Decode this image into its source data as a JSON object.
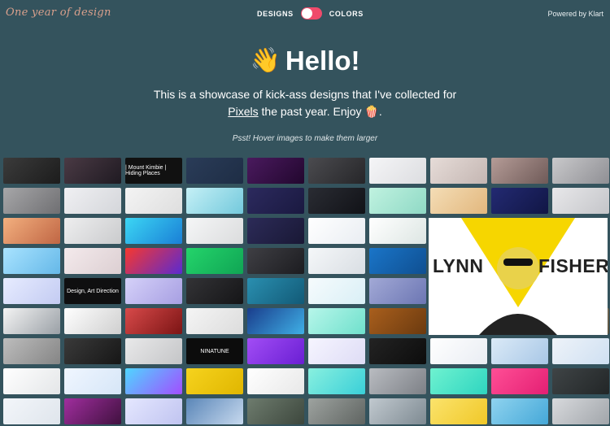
{
  "header": {
    "logo": "One year of design",
    "toggle_left": "DESIGNS",
    "toggle_right": "COLORS",
    "powered": "Powered by Klart"
  },
  "hero": {
    "wave_icon": "👋",
    "title": "Hello!",
    "intro_before": "This is a showcase of kick-ass designs that I've collected for ",
    "intro_link": "Pixels",
    "intro_after": " the past year. Enjoy ",
    "popcorn_icon": "🍿",
    "intro_end": ".",
    "hint": "Psst! Hover images to make them larger"
  },
  "tiles": [
    {
      "row": 0,
      "col": 0,
      "bg": "linear-gradient(135deg,#3b3b3b,#1c1c1c)"
    },
    {
      "row": 0,
      "col": 1,
      "bg": "linear-gradient(135deg,#4a3a44,#1f1a22)"
    },
    {
      "row": 0,
      "col": 2,
      "bg": "#111111",
      "text": "| Mount Kimbie | Hiding Places"
    },
    {
      "row": 0,
      "col": 3,
      "bg": "linear-gradient(135deg,#2a3c58,#1e2d45)"
    },
    {
      "row": 0,
      "col": 4,
      "bg": "linear-gradient(135deg,#4a1a5e,#22072e)"
    },
    {
      "row": 0,
      "col": 5,
      "bg": "linear-gradient(135deg,#4b4b4f,#262629)"
    },
    {
      "row": 0,
      "col": 6,
      "bg": "linear-gradient(135deg,#f5f5f7,#dcdde0)"
    },
    {
      "row": 0,
      "col": 7,
      "bg": "linear-gradient(135deg,#e6dcd8,#c4b6b2)"
    },
    {
      "row": 0,
      "col": 8,
      "bg": "linear-gradient(135deg,#b59c97,#6f5a58)"
    },
    {
      "row": 0,
      "col": 9,
      "bg": "linear-gradient(135deg,#c9c9cb,#8f8f94)"
    },
    {
      "row": 1,
      "col": 0,
      "bg": "linear-gradient(135deg,#a7a7a9,#6f6f72)"
    },
    {
      "row": 1,
      "col": 1,
      "bg": "linear-gradient(135deg,#f0f0f3,#d4d6da)"
    },
    {
      "row": 1,
      "col": 2,
      "bg": "linear-gradient(135deg,#f4f4f4,#dedede)"
    },
    {
      "row": 1,
      "col": 3,
      "bg": "linear-gradient(135deg,#c5f0f6,#73c9dc)"
    },
    {
      "row": 1,
      "col": 4,
      "bg": "linear-gradient(135deg,#2c2a5e,#1a1940)"
    },
    {
      "row": 1,
      "col": 5,
      "bg": "linear-gradient(135deg,#2a2c33,#111217)"
    },
    {
      "row": 1,
      "col": 6,
      "bg": "linear-gradient(135deg,#c0f2e0,#8fd9c5)"
    },
    {
      "row": 1,
      "col": 7,
      "bg": "linear-gradient(135deg,#f4ddb6,#e2b77d)"
    },
    {
      "row": 1,
      "col": 8,
      "bg": "linear-gradient(135deg,#232a72,#111645)"
    },
    {
      "row": 1,
      "col": 9,
      "bg": "linear-gradient(135deg,#e8e8ea,#c4c5c9)"
    },
    {
      "row": 2,
      "col": 0,
      "bg": "linear-gradient(135deg,#f3b07f,#c06644)"
    },
    {
      "row": 2,
      "col": 1,
      "bg": "linear-gradient(135deg,#eeeeef,#cacbcd)"
    },
    {
      "row": 2,
      "col": 2,
      "bg": "linear-gradient(135deg,#3cd6f4,#1a7fd6)"
    },
    {
      "row": 2,
      "col": 3,
      "bg": "linear-gradient(135deg,#f5f6f7,#dbdcdd)"
    },
    {
      "row": 2,
      "col": 4,
      "bg": "linear-gradient(135deg,#2c2b58,#191835)"
    },
    {
      "row": 2,
      "col": 5,
      "bg": "linear-gradient(135deg,#ffffff,#e9edf2)"
    },
    {
      "row": 2,
      "col": 6,
      "bg": "linear-gradient(135deg,#ffffff,#dde6e3)"
    },
    {
      "row": 3,
      "col": 0,
      "bg": "linear-gradient(135deg,#a9e3ff,#65b8e8)"
    },
    {
      "row": 3,
      "col": 1,
      "bg": "linear-gradient(135deg,#f4eaec,#dccfd2)"
    },
    {
      "row": 3,
      "col": 2,
      "bg": "linear-gradient(135deg,#f7382e,#5a2ad1)"
    },
    {
      "row": 3,
      "col": 3,
      "bg": "linear-gradient(135deg,#24d46b,#10a554)"
    },
    {
      "row": 3,
      "col": 4,
      "bg": "linear-gradient(135deg,#3f3f44,#1c1c20)"
    },
    {
      "row": 3,
      "col": 5,
      "bg": "linear-gradient(135deg,#f5f7f9,#d9dee3)"
    },
    {
      "row": 3,
      "col": 6,
      "bg": "linear-gradient(135deg,#1a75c8,#0f4f91)"
    },
    {
      "row": 4,
      "col": 0,
      "bg": "linear-gradient(135deg,#e7ecff,#c3cbf2)"
    },
    {
      "row": 4,
      "col": 1,
      "bg": "#0f0f10",
      "text": "Design, Art Direction"
    },
    {
      "row": 4,
      "col": 2,
      "bg": "linear-gradient(135deg,#d5d1f9,#a79fe2)"
    },
    {
      "row": 4,
      "col": 3,
      "bg": "linear-gradient(135deg,#333336,#151517)"
    },
    {
      "row": 4,
      "col": 4,
      "bg": "linear-gradient(135deg,#2a8fb0,#125a77)"
    },
    {
      "row": 4,
      "col": 5,
      "bg": "linear-gradient(135deg,#f6fbfd,#d9eff6)"
    },
    {
      "row": 4,
      "col": 6,
      "bg": "linear-gradient(135deg,#a2a9d6,#6c76b3)"
    },
    {
      "row": 5,
      "col": 0,
      "bg": "linear-gradient(135deg,#f4f4f4,#9aa0a6)"
    },
    {
      "row": 5,
      "col": 1,
      "bg": "linear-gradient(135deg,#ffffff,#cfcfcf)"
    },
    {
      "row": 5,
      "col": 2,
      "bg": "linear-gradient(135deg,#d84a4a,#7b1414)"
    },
    {
      "row": 5,
      "col": 3,
      "bg": "linear-gradient(135deg,#f5f5f5,#dcdcdc)"
    },
    {
      "row": 5,
      "col": 4,
      "bg": "linear-gradient(135deg,#1a3d8c,#3fb0e6)"
    },
    {
      "row": 5,
      "col": 5,
      "bg": "linear-gradient(135deg,#b7f6ea,#6fe0cc)"
    },
    {
      "row": 5,
      "col": 6,
      "bg": "linear-gradient(135deg,#a95f1d,#6b3a0f)"
    },
    {
      "row": 5,
      "col": 7,
      "bg": "linear-gradient(135deg,#d3cfcf,#8d8787)"
    },
    {
      "row": 5,
      "col": 8,
      "bg": "linear-gradient(135deg,#f7f9fb,#e1e7ee)"
    },
    {
      "row": 5,
      "col": 9,
      "bg": "linear-gradient(135deg,#8d8571,#595240)"
    },
    {
      "row": 6,
      "col": 0,
      "bg": "linear-gradient(135deg,#bdbdbd,#858585)"
    },
    {
      "row": 6,
      "col": 1,
      "bg": "linear-gradient(135deg,#3a3a3a,#161616)"
    },
    {
      "row": 6,
      "col": 2,
      "bg": "linear-gradient(135deg,#e9e9ea,#c4c5c7)"
    },
    {
      "row": 6,
      "col": 3,
      "bg": "#0c0c0c",
      "text": "NINATUNE"
    },
    {
      "row": 6,
      "col": 4,
      "bg": "linear-gradient(135deg,#a24df5,#6a1fd3)"
    },
    {
      "row": 6,
      "col": 5,
      "bg": "linear-gradient(135deg,#f6f5ff,#dedcf5)"
    },
    {
      "row": 6,
      "col": 6,
      "bg": "linear-gradient(135deg,#232323,#0c0c0c)"
    },
    {
      "row": 6,
      "col": 7,
      "bg": "linear-gradient(135deg,#ffffff,#e9edf3)"
    },
    {
      "row": 6,
      "col": 8,
      "bg": "linear-gradient(135deg,#dbeaf7,#a8c7e6)"
    },
    {
      "row": 6,
      "col": 9,
      "bg": "linear-gradient(135deg,#eef3f9,#cfe0f2)"
    },
    {
      "row": 7,
      "col": 0,
      "bg": "linear-gradient(135deg,#ffffff,#e4e6e8)"
    },
    {
      "row": 7,
      "col": 1,
      "bg": "linear-gradient(135deg,#f0f6ff,#d6e6f7)"
    },
    {
      "row": 7,
      "col": 2,
      "bg": "linear-gradient(135deg,#4fd6ff,#a24dff)"
    },
    {
      "row": 7,
      "col": 3,
      "bg": "linear-gradient(135deg,#f6d31e,#e0b600)"
    },
    {
      "row": 7,
      "col": 4,
      "bg": "linear-gradient(135deg,#ffffff,#e8e8e8)"
    },
    {
      "row": 7,
      "col": 5,
      "bg": "linear-gradient(135deg,#89f0df,#39cfd8)"
    },
    {
      "row": 7,
      "col": 6,
      "bg": "linear-gradient(135deg,#b9bcc1,#7d8086)"
    },
    {
      "row": 7,
      "col": 7,
      "bg": "linear-gradient(135deg,#6ff2d0,#2ed5c0)"
    },
    {
      "row": 7,
      "col": 8,
      "bg": "linear-gradient(135deg,#ff4f96,#e41f73)"
    },
    {
      "row": 7,
      "col": 9,
      "bg": "linear-gradient(135deg,#3f4446,#222627)"
    },
    {
      "row": 8,
      "col": 0,
      "bg": "linear-gradient(135deg,#f3f6fa,#dfe5ec)"
    },
    {
      "row": 8,
      "col": 1,
      "bg": "linear-gradient(135deg,#a02e9e,#40113f)"
    },
    {
      "row": 8,
      "col": 2,
      "bg": "linear-gradient(135deg,#e5e7ff,#c0c4f0)"
    },
    {
      "row": 8,
      "col": 3,
      "bg": "linear-gradient(135deg,#5a86b8,#c7d9ee)"
    },
    {
      "row": 8,
      "col": 4,
      "bg": "linear-gradient(135deg,#6e7c6e,#3d473d)"
    },
    {
      "row": 8,
      "col": 5,
      "bg": "linear-gradient(135deg,#9ea3a0,#5f6461)"
    },
    {
      "row": 8,
      "col": 6,
      "bg": "linear-gradient(135deg,#c1c9cf,#7e8a92)"
    },
    {
      "row": 8,
      "col": 7,
      "bg": "linear-gradient(135deg,#fbe36c,#f0c828)"
    },
    {
      "row": 8,
      "col": 8,
      "bg": "linear-gradient(135deg,#8fd3ef,#45a8d8)"
    },
    {
      "row": 8,
      "col": 9,
      "bg": "linear-gradient(135deg,#d8dadd,#a1a5aa)"
    }
  ],
  "featured": {
    "first": "LYNN",
    "last": "FISHER",
    "accent": "#f6d600"
  }
}
